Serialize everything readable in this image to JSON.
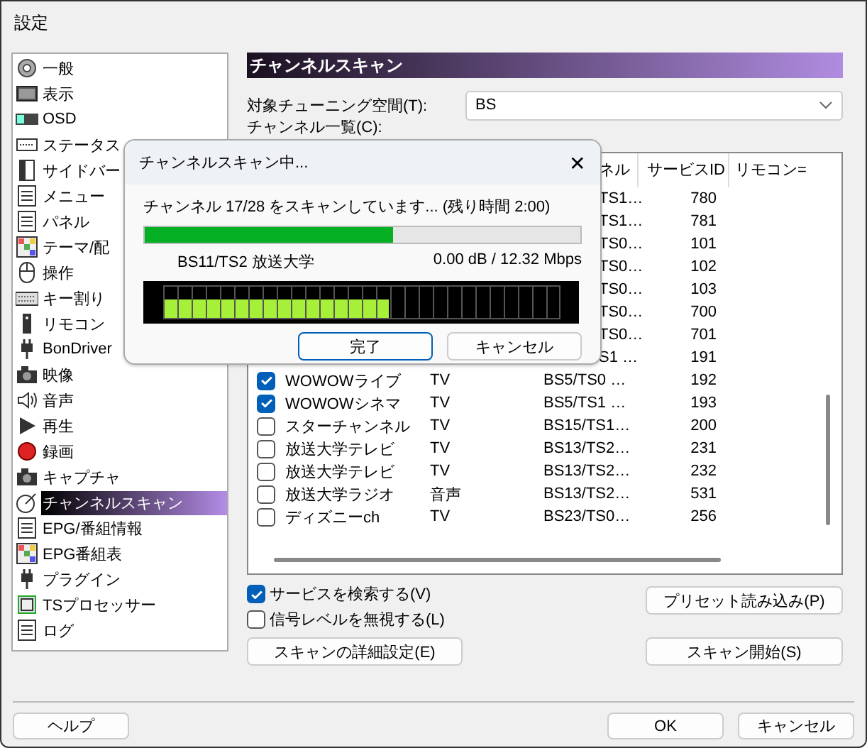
{
  "window": {
    "title": "設定"
  },
  "sidebar": {
    "items": [
      {
        "label": "一般",
        "selected": false
      },
      {
        "label": "表示",
        "selected": false
      },
      {
        "label": "OSD",
        "selected": false
      },
      {
        "label": "ステータス",
        "selected": false
      },
      {
        "label": "サイドバー",
        "selected": false
      },
      {
        "label": "メニュー",
        "selected": false
      },
      {
        "label": "パネル",
        "selected": false
      },
      {
        "label": "テーマ/配",
        "selected": false
      },
      {
        "label": "操作",
        "selected": false
      },
      {
        "label": "キー割り",
        "selected": false
      },
      {
        "label": "リモコン",
        "selected": false
      },
      {
        "label": "BonDriver",
        "selected": false
      },
      {
        "label": "映像",
        "selected": false
      },
      {
        "label": "音声",
        "selected": false
      },
      {
        "label": "再生",
        "selected": false
      },
      {
        "label": "録画",
        "selected": false
      },
      {
        "label": "キャプチャ",
        "selected": false
      },
      {
        "label": "チャンネルスキャン",
        "selected": true
      },
      {
        "label": "EPG/番組情報",
        "selected": false
      },
      {
        "label": "EPG番組表",
        "selected": false
      },
      {
        "label": "プラグイン",
        "selected": false
      },
      {
        "label": "TSプロセッサー",
        "selected": false
      },
      {
        "label": "ログ",
        "selected": false
      }
    ]
  },
  "panel": {
    "title": "チャンネルスキャン",
    "tuning_space": {
      "label": "対象チューニング空間(T):",
      "value": "BS"
    },
    "channel_list_label": "チャンネル一覧(C):",
    "table": {
      "columns": [
        "ネル",
        "サービスID",
        "リモコン="
      ],
      "rows": [
        {
          "channel": "TS1…",
          "service_id": "780"
        },
        {
          "channel": "TS1…",
          "service_id": "781"
        },
        {
          "channel": "TS0…",
          "service_id": "101"
        },
        {
          "channel": "TS0…",
          "service_id": "102"
        },
        {
          "channel": "TS0…",
          "service_id": "103"
        },
        {
          "channel": "TS0…",
          "service_id": "700"
        },
        {
          "channel": "TS0…",
          "service_id": "701"
        },
        {
          "channel": "S1 …",
          "service_id": "191"
        },
        {
          "name": "WOWOWライブ",
          "type": "TV",
          "channel": "BS5/TS0 …",
          "service_id": "192",
          "checked": true
        },
        {
          "name": "WOWOWシネマ",
          "type": "TV",
          "channel": "BS5/TS1 …",
          "service_id": "193",
          "checked": true
        },
        {
          "name": "スターチャンネル",
          "type": "TV",
          "channel": "BS15/TS1…",
          "service_id": "200",
          "checked": false
        },
        {
          "name": "放送大学テレビ",
          "type": "TV",
          "channel": "BS13/TS2…",
          "service_id": "231",
          "checked": false
        },
        {
          "name": "放送大学テレビ",
          "type": "TV",
          "channel": "BS13/TS2…",
          "service_id": "232",
          "checked": false
        },
        {
          "name": "放送大学ラジオ",
          "type": "音声",
          "channel": "BS13/TS2…",
          "service_id": "531",
          "checked": false
        },
        {
          "name": "ディズニーch",
          "type": "TV",
          "channel": "BS23/TS0…",
          "service_id": "256",
          "checked": false
        }
      ]
    },
    "options": [
      {
        "label": "サービスを検索する(V)",
        "checked": true
      },
      {
        "label": "信号レベルを無視する(L)",
        "checked": false
      }
    ],
    "detail_button": "スキャンの詳細設定(E)",
    "preset_button": "プリセット読み込み(P)",
    "start_button": "スキャン開始(S)"
  },
  "footer": {
    "help": "ヘルプ",
    "ok": "OK",
    "cancel": "キャンセル"
  },
  "dialog": {
    "title": "チャンネルスキャン中...",
    "close": "✕",
    "status": "チャンネル 17/28 をスキャンしています... (残り時間 2:00)",
    "progress": {
      "level": 0.57
    },
    "channel": "BS11/TS2 放送大学",
    "reading": "0.00 dB / 12.32 Mbps",
    "signal_meter": {
      "level": 0.571
    },
    "buttons": [
      {
        "label": "完了",
        "kind": "primary"
      },
      {
        "label": "キャンセル",
        "kind": "normal"
      }
    ]
  }
}
